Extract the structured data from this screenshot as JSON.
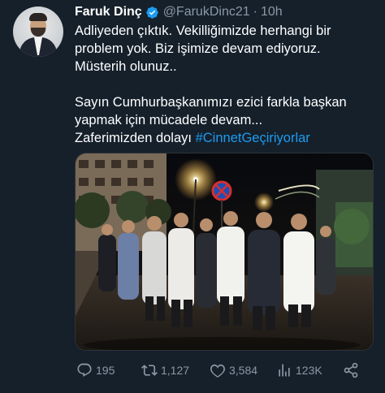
{
  "author": {
    "name": "Faruk Dinç",
    "handle": "@FarukDinc21",
    "separator": "·",
    "time": "10h",
    "verified_color": "#1d9bf0"
  },
  "tweet": {
    "lines": [
      "Adliyeden çıktık. Vekilliğimizde herhangi bir",
      "problem yok. Biz işimize devam ediyoruz.",
      "Müsterih olunuz..",
      "Sayın Cumhurbaşkanımızı ezici farkla başkan",
      "yapmak için mücadele devam...",
      "Zaferimizden dolayı"
    ],
    "hashtag": "#CinnetGeçiriyorlar"
  },
  "media": {
    "type": "photo",
    "scene": "night-street-group-of-men"
  },
  "actions": {
    "reply_count": "195",
    "retweet_count": "1,127",
    "like_count": "3,584",
    "view_count": "123K",
    "icons": [
      "reply-icon",
      "retweet-icon",
      "like-icon",
      "views-icon",
      "share-icon"
    ]
  },
  "colors": {
    "background": "#15202b",
    "text": "#ffffff",
    "muted": "#8b98a5",
    "accent": "#1d9bf0"
  }
}
